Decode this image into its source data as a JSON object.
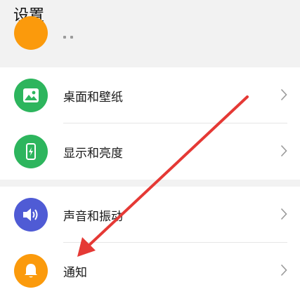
{
  "page": {
    "title": "设置"
  },
  "partial_item": {
    "label": "",
    "icon": "orange-circle-icon"
  },
  "groups": [
    {
      "items": [
        {
          "label": "桌面和壁纸",
          "icon": "wallpaper-icon",
          "color": "#2db55d"
        },
        {
          "label": "显示和亮度",
          "icon": "display-brightness-icon",
          "color": "#2db55d"
        }
      ]
    },
    {
      "items": [
        {
          "label": "声音和振动",
          "icon": "speaker-icon",
          "color": "#4f5bd5"
        },
        {
          "label": "通知",
          "icon": "bell-icon",
          "color": "#fb9a0c"
        }
      ]
    }
  ],
  "annotation": {
    "arrow_color": "#e53935"
  }
}
